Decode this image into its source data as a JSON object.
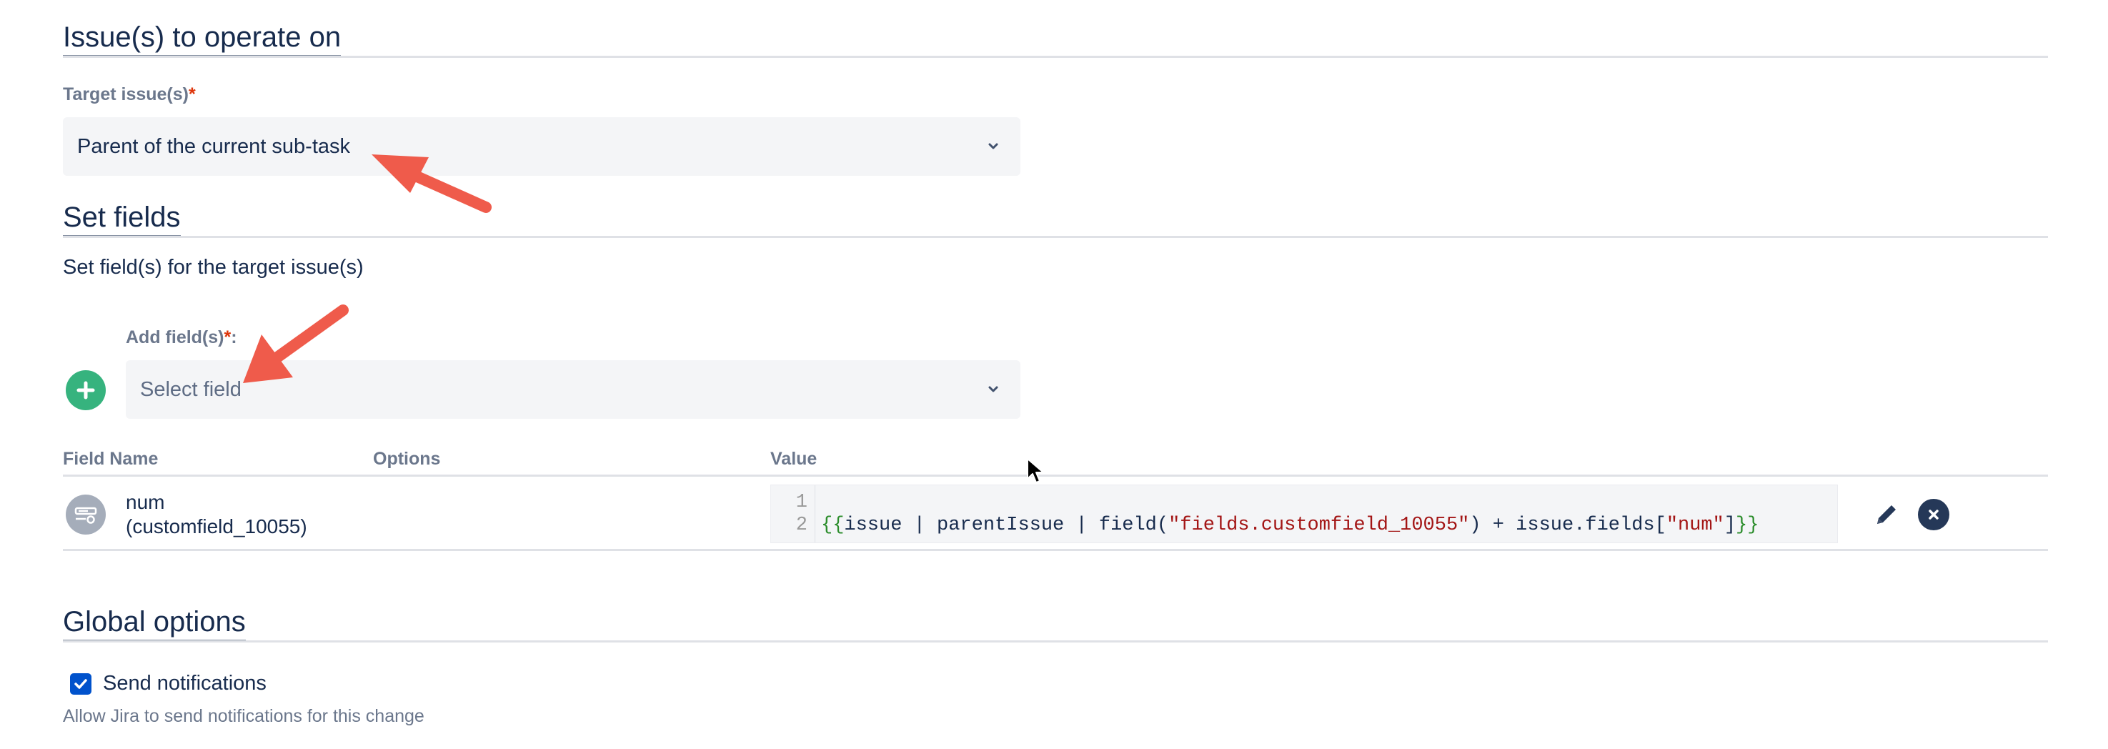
{
  "sections": {
    "issues": {
      "title": "Issue(s) to operate on"
    },
    "set_fields": {
      "title": "Set fields",
      "description": "Set field(s) for the target issue(s)"
    },
    "global": {
      "title": "Global options"
    }
  },
  "target": {
    "label": "Target issue(s)",
    "required_mark": "*",
    "value": "Parent of the current sub-task"
  },
  "add_field": {
    "label": "Add field(s)",
    "required_mark": "*",
    "label_suffix": ":",
    "placeholder": "Select field"
  },
  "table": {
    "headers": {
      "field_name": "Field Name",
      "options": "Options",
      "value": "Value"
    },
    "rows": [
      {
        "name": "num",
        "id": "(customfield_10055)",
        "code": {
          "line_numbers": [
            "1",
            "2"
          ],
          "segments": {
            "open": "{{",
            "part1": "issue | parentIssue | field(",
            "str1": "\"fields.customfield_10055\"",
            "part2": ") + issue.fields[",
            "str2": "\"num\"",
            "part3": "]",
            "close": "}}"
          }
        }
      }
    ]
  },
  "notifications": {
    "label": "Send notifications",
    "checked": true,
    "helper": "Allow Jira to send notifications for this change"
  },
  "colors": {
    "add_button": "#36b37e",
    "checkbox": "#0052cc",
    "annotation_arrow": "#ef5b4b",
    "required": "#de350b"
  }
}
